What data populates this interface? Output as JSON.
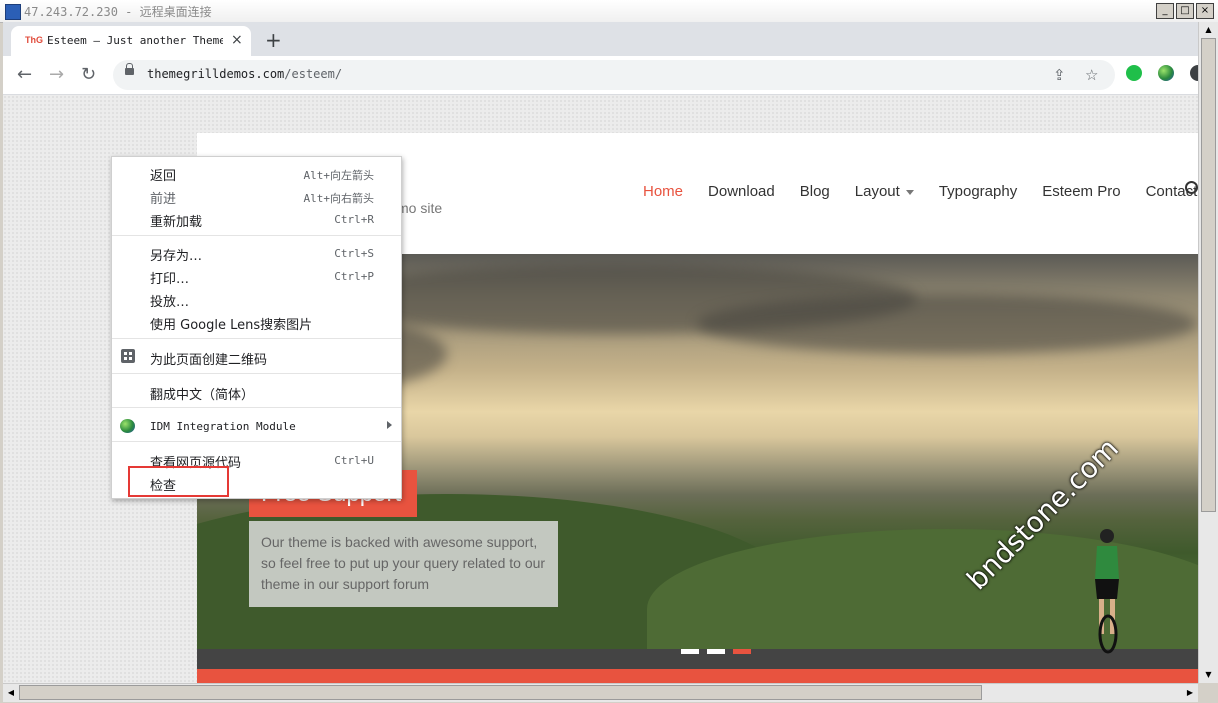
{
  "rdp": {
    "title": "47.243.72.230 - 远程桌面连接",
    "buttons": [
      "_",
      "□",
      "×"
    ]
  },
  "tab": {
    "favicon_text": "ThG",
    "title": "Esteem — Just another ThemeGrill",
    "close": "×",
    "new_tab": "+"
  },
  "toolbar": {
    "back": "←",
    "forward": "→",
    "reload": "↻",
    "url_host": "themegrilldemos.com",
    "url_path": "/esteem/",
    "share": "⇪",
    "star": "☆"
  },
  "site": {
    "tagline": "mo site",
    "nav": [
      {
        "label": "Home",
        "active": true
      },
      {
        "label": "Download"
      },
      {
        "label": "Blog"
      },
      {
        "label": "Layout",
        "has_caret": true
      },
      {
        "label": "Typography"
      },
      {
        "label": "Esteem Pro"
      },
      {
        "label": "Contact"
      }
    ],
    "slide_heading": "Free Support",
    "slide_text": "Our theme is backed with awesome support, so feel free to put up your query related to our theme in our support forum",
    "slide_dots": 3,
    "active_dot": 3
  },
  "watermark": "bndstone.com",
  "context_menu": {
    "items": [
      {
        "label": "返回",
        "shortcut": "Alt+向左箭头"
      },
      {
        "label": "前进",
        "shortcut": "Alt+向右箭头"
      },
      {
        "label": "重新加载",
        "shortcut": "Ctrl+R"
      },
      {
        "label": "另存为…",
        "shortcut": "Ctrl+S"
      },
      {
        "label": "打印…",
        "shortcut": "Ctrl+P"
      },
      {
        "label": "投放…",
        "shortcut": ""
      },
      {
        "label": "使用 Google Lens搜索图片",
        "shortcut": ""
      },
      {
        "label": "为此页面创建二维码",
        "shortcut": ""
      },
      {
        "label": "翻成中文（简体）",
        "shortcut": ""
      },
      {
        "label": "IDM Integration Module",
        "shortcut": ""
      },
      {
        "label": "查看网页源代码",
        "shortcut": "Ctrl+U"
      },
      {
        "label": "检查",
        "shortcut": ""
      }
    ]
  },
  "scrollbar": {
    "up": "▲",
    "down": "▼",
    "left": "◀",
    "right": "▶"
  },
  "colors": {
    "accent": "#e8533f",
    "highlight_border": "#e53935"
  }
}
